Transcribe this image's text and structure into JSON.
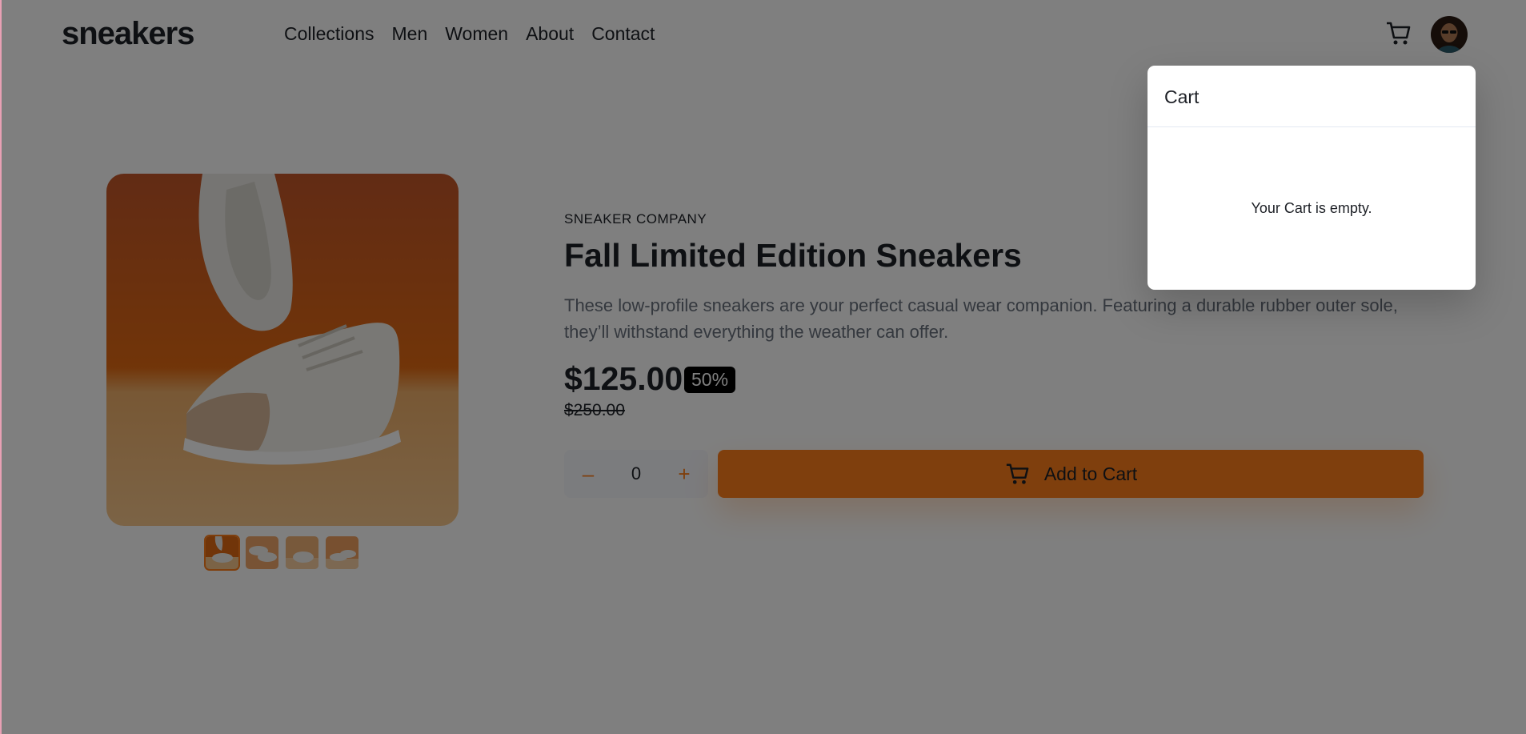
{
  "header": {
    "logo": "sneakers",
    "nav": [
      "Collections",
      "Men",
      "Women",
      "About",
      "Contact"
    ],
    "cart_icon": "cart-icon",
    "avatar": "user-avatar"
  },
  "product": {
    "company": "SNEAKER COMPANY",
    "title": "Fall Limited Edition Sneakers",
    "description": "These low-profile sneakers are your perfect casual wear companion. Featuring a durable rubber outer sole, they’ll withstand everything the weather can offer.",
    "price": "$125.00",
    "discount": "50%",
    "old_price": "$250.00"
  },
  "quantity": {
    "minus": "–",
    "value": "0",
    "plus": "+"
  },
  "add_to_cart": {
    "label": "Add to Cart",
    "icon": "cart-icon"
  },
  "cart": {
    "title": "Cart",
    "empty_message": "Your Cart is empty."
  },
  "colors": {
    "accent": "#ff7e1b",
    "dark": "#1d2026",
    "muted": "#68707d",
    "overlay": "rgba(0,0,0,0.5)"
  }
}
